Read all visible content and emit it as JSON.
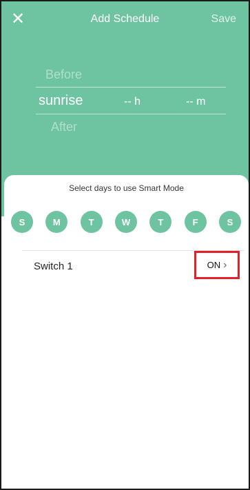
{
  "header": {
    "close_icon": "close-icon",
    "title": "Add Schedule",
    "save_label": "Save",
    "background_color": "#6ec4a0"
  },
  "time_picker": {
    "above_option": "Before",
    "selected_period": "sunrise",
    "hour": "-- h",
    "minute": "-- m",
    "below_option": "After"
  },
  "days_section": {
    "label": "Select days to use Smart Mode",
    "days": [
      "S",
      "M",
      "T",
      "W",
      "T",
      "F",
      "S"
    ],
    "accent_color": "#6ec4a0"
  },
  "switch": {
    "label": "Switch 1",
    "value": "ON",
    "chevron_icon": "chevron-right-icon",
    "highlight_color": "#e0202a"
  }
}
